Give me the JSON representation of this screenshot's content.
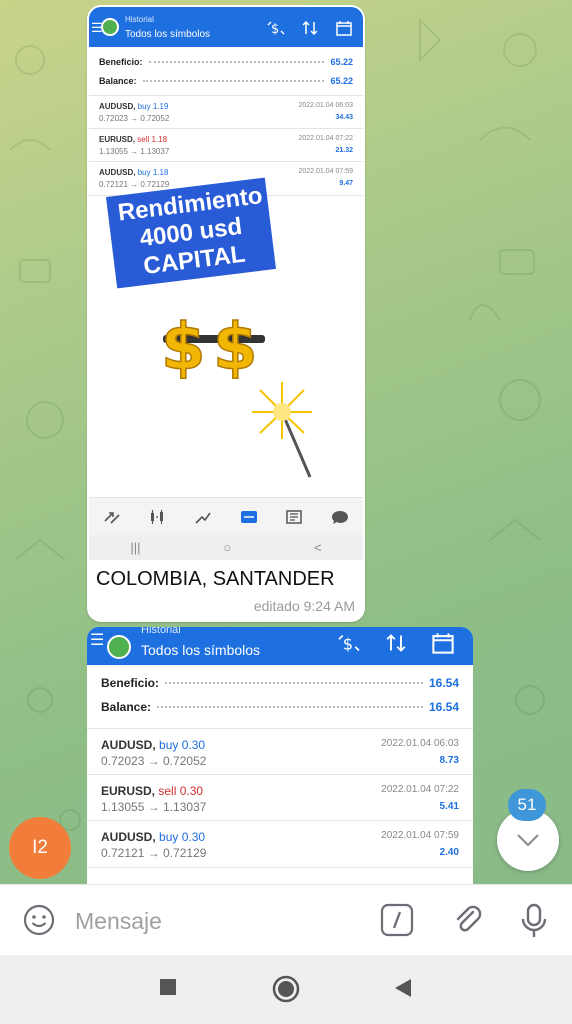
{
  "screenshot1": {
    "header": {
      "subtitle": "Historial",
      "title": "Todos los símbolos"
    },
    "summary": [
      {
        "label": "Beneficio:",
        "value": "65.22"
      },
      {
        "label": "Balance:",
        "value": "65.22"
      }
    ],
    "deals": [
      {
        "symbol": "AUDUSD,",
        "side": "buy",
        "volume": "1.19",
        "prices": "0.72023 → 0.72052",
        "date": "2022.01.04 06:03",
        "profit": "34.43"
      },
      {
        "symbol": "EURUSD,",
        "side": "sell",
        "volume": "1.18",
        "prices": "1.13055 → 1.13037",
        "date": "2022.01.04 07:22",
        "profit": "21.32"
      },
      {
        "symbol": "AUDUSD,",
        "side": "buy",
        "volume": "1.18",
        "prices": "0.72121 → 0.72129",
        "date": "2022.01.04 07:59",
        "profit": "9.47"
      }
    ],
    "sticker_lines": [
      "Rendimiento",
      "4000 usd",
      "CAPITAL"
    ],
    "bottom_nav_icons": [
      "quotes-icon",
      "chart-icon",
      "trade-icon",
      "history-icon",
      "news-icon",
      "chat-icon"
    ],
    "system_nav": [
      "|||",
      "○",
      "<"
    ]
  },
  "message1": {
    "caption": "COLOMBIA, SANTANDER",
    "edited": "editado 9:24 AM"
  },
  "screenshot2": {
    "header": {
      "subtitle": "Historial",
      "title": "Todos los símbolos"
    },
    "summary": [
      {
        "label": "Beneficio:",
        "value": "16.54"
      },
      {
        "label": "Balance:",
        "value": "16.54"
      }
    ],
    "deals": [
      {
        "symbol": "AUDUSD,",
        "side": "buy",
        "volume": "0.30",
        "prices": "0.72023 → 0.72052",
        "date": "2022.01.04 06:03",
        "profit": "8.73"
      },
      {
        "symbol": "EURUSD,",
        "side": "sell",
        "volume": "0.30",
        "prices": "1.13055 → 1.13037",
        "date": "2022.01.04 07:22",
        "profit": "5.41"
      },
      {
        "symbol": "AUDUSD,",
        "side": "buy",
        "volume": "0.30",
        "prices": "0.72121 → 0.72129",
        "date": "2022.01.04 07:59",
        "profit": "2.40"
      }
    ]
  },
  "avatar": {
    "initials": "I2",
    "color": "#f27c3a"
  },
  "scroll": {
    "unread_count": "51"
  },
  "input": {
    "placeholder": "Mensaje"
  },
  "colors": {
    "accent": "#1e6fe0",
    "sell": "#d32f2f",
    "badge": "#2a5bd7",
    "unread": "#3f96d8"
  }
}
